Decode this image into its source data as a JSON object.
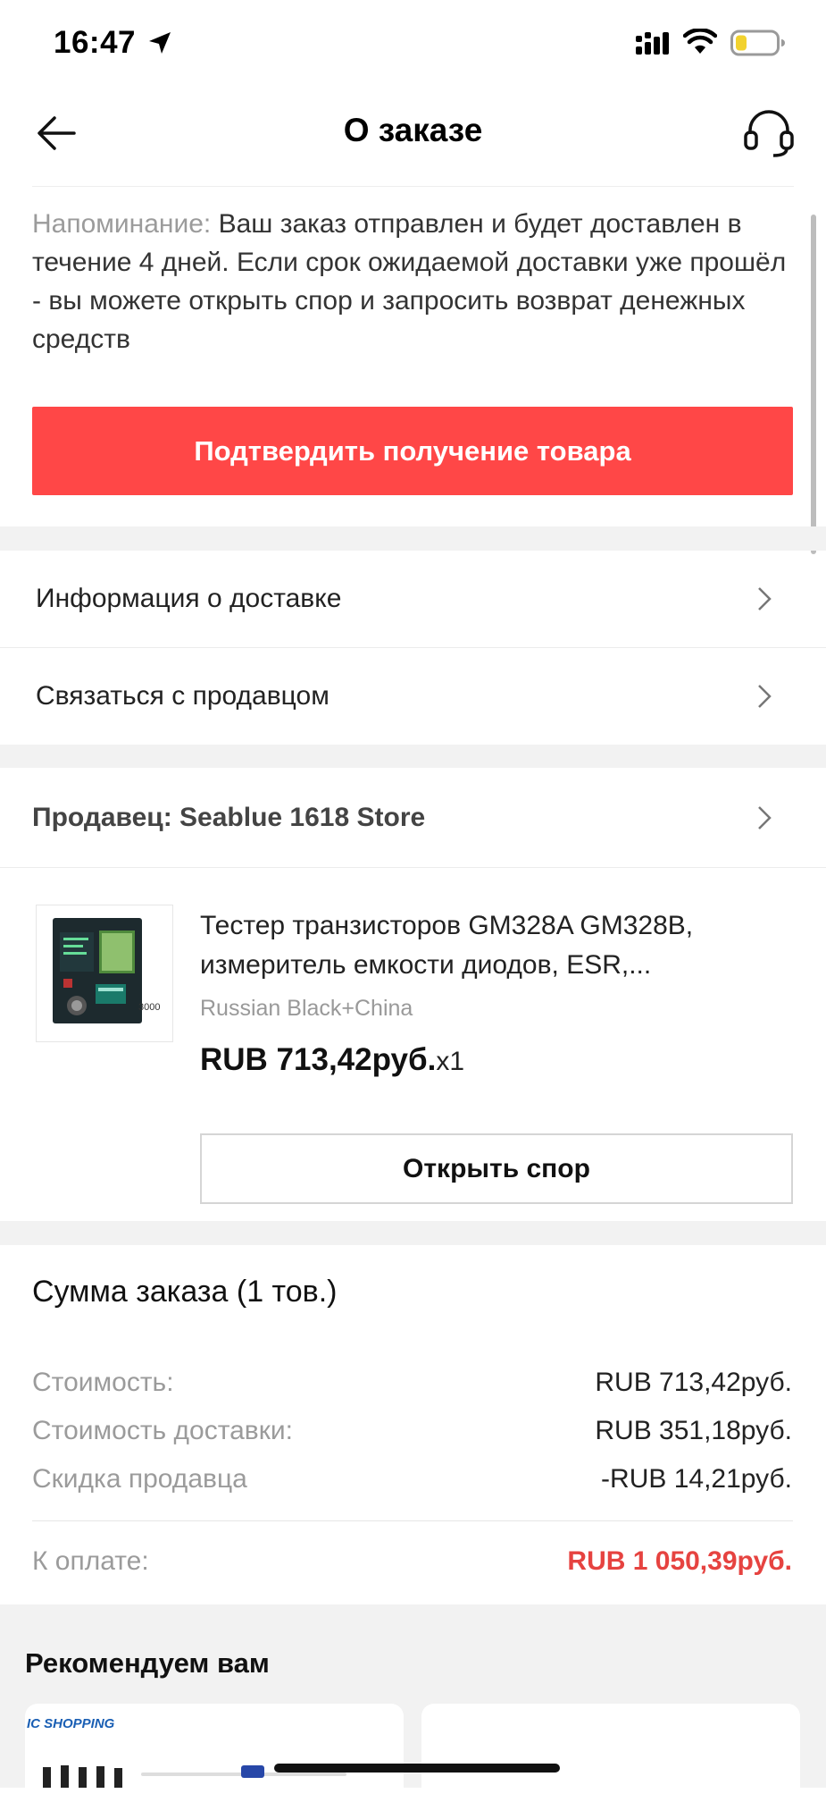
{
  "status_bar": {
    "time": "16:47"
  },
  "header": {
    "title": "О заказе"
  },
  "reminder": {
    "label": "Напоминание:",
    "text": " Ваш заказ отправлен и будет доставлен в течение 4 дней. Если срок ожидаемой доставки уже прошёл - вы можете открыть спор и запросить возврат денежных средств"
  },
  "confirm_button": "Подтвердить получение товара",
  "links": {
    "delivery_info": "Информация о доставке",
    "contact_seller": "Связаться с продавцом"
  },
  "seller": {
    "label": "Продавец: Seablue 1618 Store"
  },
  "product": {
    "name": "Тестер транзисторов GM328A GM328B, измеритель емкости диодов, ESR,...",
    "variant": "Russian Black+China",
    "price": "RUB 713,42руб.",
    "quantity": "x1",
    "image_text": "3000"
  },
  "dispute_button": "Открыть спор",
  "summary": {
    "title": "Сумма заказа (1 тов.)",
    "cost_label": "Стоимость:",
    "cost_value": "RUB 713,42руб.",
    "shipping_label": "Стоимость доставки:",
    "shipping_value": "RUB 351,18руб.",
    "discount_label": "Скидка продавца",
    "discount_value": "-RUB 14,21руб.",
    "total_label": "К оплате:",
    "total_value": "RUB 1 050,39руб."
  },
  "recommendations": {
    "title": "Рекомендуем вам",
    "card1_logo": "IC SHOPPING"
  },
  "colors": {
    "accent": "#ff4747",
    "total": "#e64340",
    "section_gap": "#f2f2f2"
  }
}
